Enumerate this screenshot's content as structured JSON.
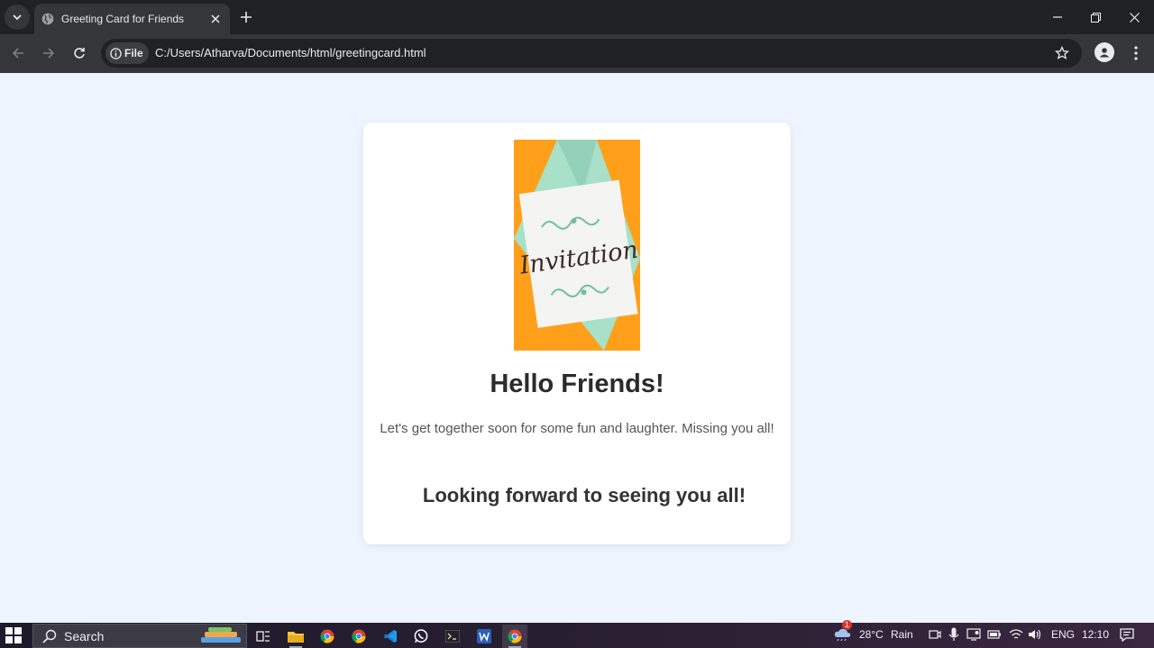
{
  "browser": {
    "tab_title": "Greeting Card for Friends",
    "chip_label": "File",
    "url": "C:/Users/Atharva/Documents/html/greetingcard.html"
  },
  "card": {
    "image_text": "Invitation",
    "title": "Hello Friends!",
    "message": "Let's get together soon for some fun and laughter. Missing you all!",
    "closing": "Looking forward to seeing you all!"
  },
  "taskbar": {
    "search_label": "Search",
    "weather_badge": "1",
    "temperature": "28°C",
    "weather": "Rain",
    "language": "ENG",
    "time": "12:10"
  },
  "colors": {
    "page_background": "#eef5fe",
    "card_background": "#ffffff",
    "image_orange": "#ff9f1a",
    "image_mint": "#a8e0c8"
  }
}
